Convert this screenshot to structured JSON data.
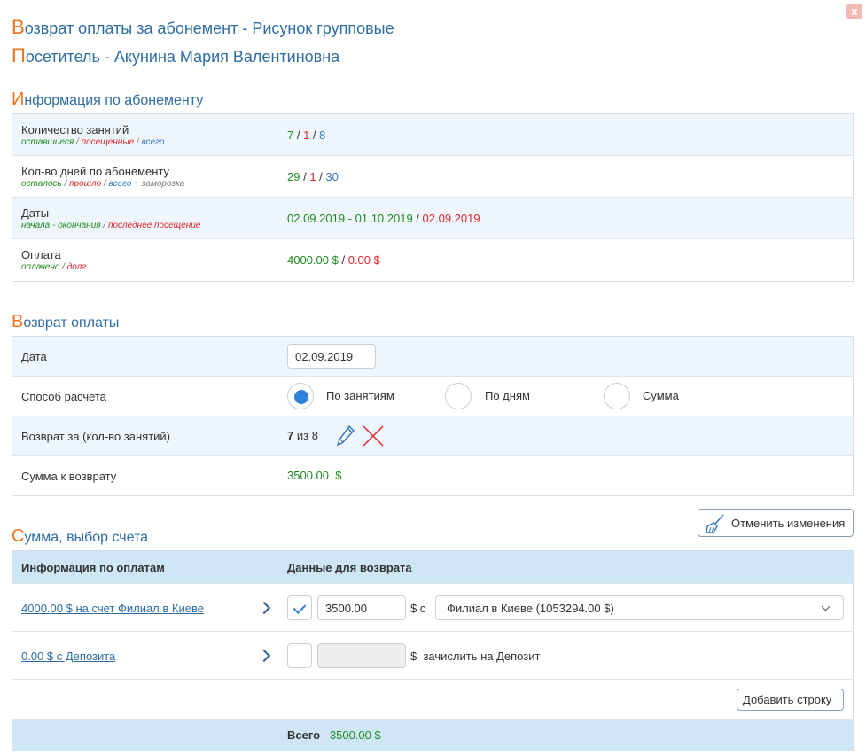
{
  "close_label": "x",
  "header": {
    "title_first": "В",
    "title_rest": "озврат оплаты за абонемент - Рисунок групповые",
    "visitor_first": "П",
    "visitor_rest": "осетитель - Акунина Мария Валентиновна"
  },
  "info": {
    "title_first": "И",
    "title_rest": "нформация по абонементу",
    "rows": [
      {
        "label": "Количество занятий",
        "sub": [
          "оставшиеся",
          "посещенные",
          "всего"
        ],
        "values": [
          "7",
          "1",
          "8"
        ]
      },
      {
        "label": "Кол-во дней по абонементу",
        "sub": [
          "осталось",
          "прошло",
          "всего",
          "+ заморозка"
        ],
        "values": [
          "29",
          "1",
          "30"
        ]
      },
      {
        "label": "Даты",
        "sub": [
          "начала - окончания",
          "последнее посещение"
        ],
        "values": [
          "02.09.2019 - 01.10.2019",
          "02.09.2019"
        ]
      },
      {
        "label": "Оплата",
        "sub": [
          "оплачено",
          "долг"
        ],
        "values": [
          "4000.00 $",
          "0.00 $"
        ]
      }
    ],
    "sep": " / "
  },
  "refund": {
    "title_first": "В",
    "title_rest": "озврат оплаты",
    "date_label": "Дата",
    "date_value": "02.09.2019",
    "method_label": "Способ расчета",
    "methods": [
      "По занятиям",
      "По дням",
      "Сумма"
    ],
    "selected_method": 0,
    "for_label": "Возврат за (кол-во занятий)",
    "for_count": "7",
    "for_of": "из 8",
    "sum_label": "Сумма к возврату",
    "sum_value": "3500.00",
    "sum_currency": "$"
  },
  "accounts": {
    "title_first": "С",
    "title_rest": "умма, выбор счета",
    "cancel_label": "Отменить изменения",
    "col_info": "Информация по оплатам",
    "col_data": "Данные для возврата",
    "rows": [
      {
        "link": "4000.00 $ на счет Филиал в Киеве",
        "checked": true,
        "amount": "3500.00",
        "suffix": "$ с",
        "account": "Филиал в Киеве (1053294.00 $)"
      },
      {
        "link": "0.00 $ с Депозита",
        "checked": false,
        "amount": "",
        "suffix": "$  зачислить на Депозит"
      }
    ],
    "add_row_label": "Добавить строку",
    "total_label": "Всего",
    "total_value": "3500.00 $"
  }
}
